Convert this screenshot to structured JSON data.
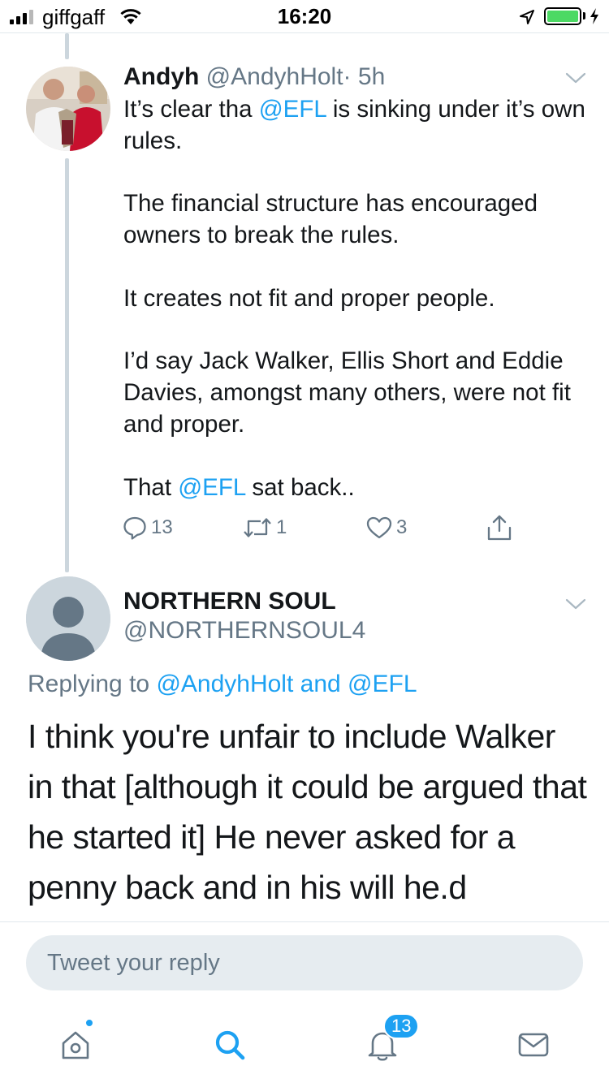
{
  "status_bar": {
    "carrier": "giffgaff",
    "time": "16:20",
    "signal_bars_filled": 3,
    "signal_bars_total": 4,
    "battery_level": 1.0,
    "battery_color": "#4cd964"
  },
  "tweet1": {
    "name": "Andyh",
    "handle": "@AndyhHolt",
    "separator": "·",
    "time": "5h",
    "body": [
      [
        {
          "t": "It’s clear tha "
        },
        {
          "t": "@EFL",
          "m": true
        },
        {
          "t": " is sinking under it’s own rules."
        }
      ],
      [
        {
          "t": "The financial structure has encouraged owners to break the rules."
        }
      ],
      [
        {
          "t": "It creates not fit and proper people."
        }
      ],
      [
        {
          "t": "I’d say Jack Walker, Ellis Short and Eddie Davies, amongst many others, were not fit and proper."
        }
      ],
      [
        {
          "t": "That "
        },
        {
          "t": "@EFL",
          "m": true
        },
        {
          "t": " sat back.."
        }
      ]
    ],
    "reply_count": "13",
    "retweet_count": "1",
    "like_count": "3"
  },
  "tweet2": {
    "name": "NORTHERN SOUL",
    "handle": "@NORTHERNSOUL4",
    "replying_prefix": "Replying to ",
    "replying_user1": "@AndyhHolt",
    "replying_and": " and ",
    "replying_user2": "@EFL",
    "body": "I think you're unfair to include Walker in that [although it could be argued that he started it] He never asked for a penny back and in his will he.d"
  },
  "reply_box": {
    "placeholder": "Tweet your reply"
  },
  "tab_bar": {
    "notification_count": "13",
    "accent": "#1da1f2"
  },
  "colors": {
    "accent": "#1da1f2",
    "muted": "#657786",
    "text": "#14171a"
  }
}
